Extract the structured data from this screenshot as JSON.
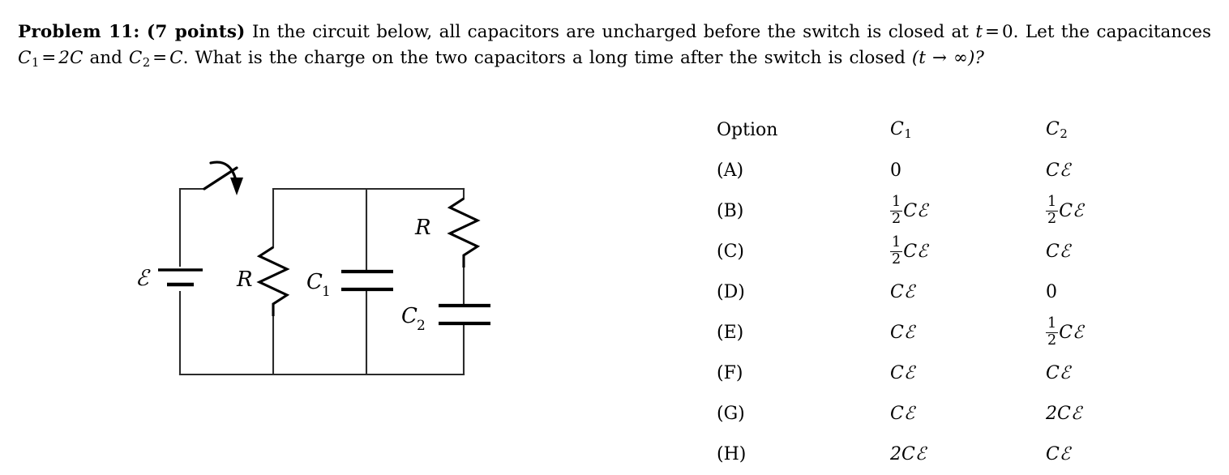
{
  "problem": {
    "label": "Problem 11:",
    "points": "(7 points)",
    "text_part_1": "In the circuit below, all capacitors are uncharged before the switch is closed at ",
    "cond_t": "t",
    "cond_eq": "=",
    "cond_zero": "0",
    "text_part_2": ". Let the capacitances ",
    "c1_sym": "C",
    "c1_sub": "1",
    "c1_eq": "=",
    "c1_val": "2C",
    "and_text": " and ",
    "c2_sym": "C",
    "c2_sub": "2",
    "c2_eq": "=",
    "c2_val": "C",
    "text_part_3": ". What is the charge on the two capacitors a long time after the switch is closed ",
    "limit": "(t → ∞)?"
  },
  "circuit": {
    "source_label": "ℰ",
    "resistor_left_label": "R",
    "capacitor_c1_label": "C",
    "capacitor_c1_sub": "1",
    "resistor_right_label": "R",
    "capacitor_c2_label": "C",
    "capacitor_c2_sub": "2",
    "switch_name": "open-switch",
    "stroke_color": "#1a1a1a"
  },
  "options": {
    "header": {
      "label": "Option",
      "c1": "C",
      "c1_sub": "1",
      "c2": "C",
      "c2_sub": "2"
    },
    "rows": [
      {
        "label": "(A)",
        "c1": {
          "type": "plain",
          "text": "0"
        },
        "c2": {
          "type": "plain",
          "text": "Cℰ"
        }
      },
      {
        "label": "(B)",
        "c1": {
          "type": "frac",
          "num": "1",
          "den": "2",
          "text": "Cℰ"
        },
        "c2": {
          "type": "frac",
          "num": "1",
          "den": "2",
          "text": "Cℰ"
        }
      },
      {
        "label": "(C)",
        "c1": {
          "type": "frac",
          "num": "1",
          "den": "2",
          "text": "Cℰ"
        },
        "c2": {
          "type": "plain",
          "text": "Cℰ"
        }
      },
      {
        "label": "(D)",
        "c1": {
          "type": "plain",
          "text": "Cℰ"
        },
        "c2": {
          "type": "plain",
          "text": "0"
        }
      },
      {
        "label": "(E)",
        "c1": {
          "type": "plain",
          "text": "Cℰ"
        },
        "c2": {
          "type": "frac",
          "num": "1",
          "den": "2",
          "text": "Cℰ"
        }
      },
      {
        "label": "(F)",
        "c1": {
          "type": "plain",
          "text": "Cℰ"
        },
        "c2": {
          "type": "plain",
          "text": "Cℰ"
        }
      },
      {
        "label": "(G)",
        "c1": {
          "type": "plain",
          "text": "Cℰ"
        },
        "c2": {
          "type": "plain",
          "text": "2Cℰ"
        }
      },
      {
        "label": "(H)",
        "c1": {
          "type": "plain",
          "text": "2Cℰ"
        },
        "c2": {
          "type": "plain",
          "text": "Cℰ"
        }
      }
    ]
  }
}
